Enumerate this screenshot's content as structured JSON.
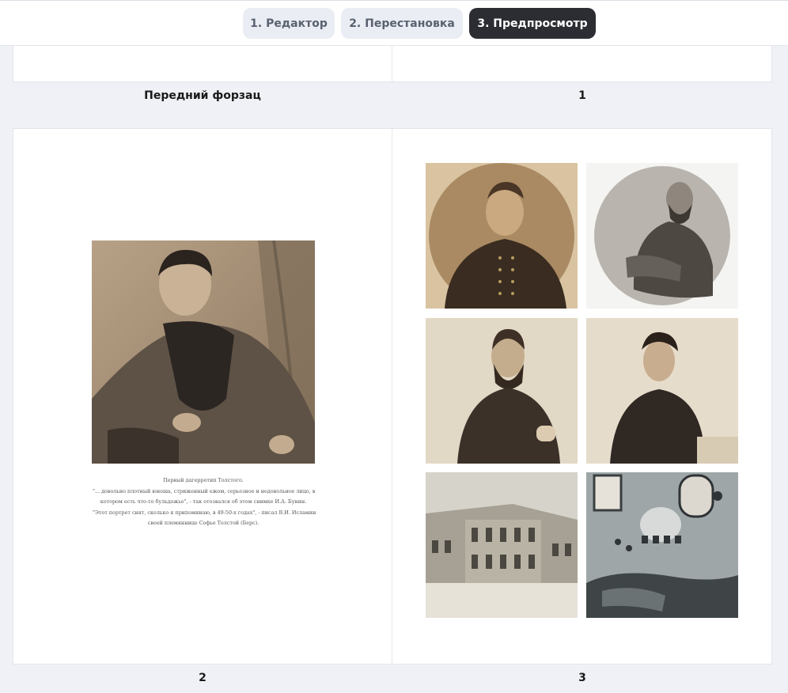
{
  "tabs": [
    {
      "label": "1. Редактор"
    },
    {
      "label": "2. Перестановка"
    },
    {
      "label": "3. Предпросмотр"
    }
  ],
  "top_spread": {
    "left_label": "Передний форзац",
    "right_label": "1"
  },
  "main_spread": {
    "left_label": "2",
    "right_label": "3",
    "caption": {
      "line1": "Первый дагерротип Толстого.",
      "line2": "\"... довольно плотный юноша, стриженный ежом, серьезное и недовольное лицо, в",
      "line3": "котором есть что-то бульдожье\", - так отозвался об этом снимке И.А. Бунин.",
      "line4": "\"Этот портрет снят, сколько я припоминаю, в 49-50-х годах\", - писал В.И. Исламин",
      "line5": "своей племяннице Софье Толстой (Берс)."
    }
  },
  "colors": {
    "active_tab": "#2c2d33",
    "inactive_tab": "#eaedf3",
    "sepia": "#b49a76"
  }
}
